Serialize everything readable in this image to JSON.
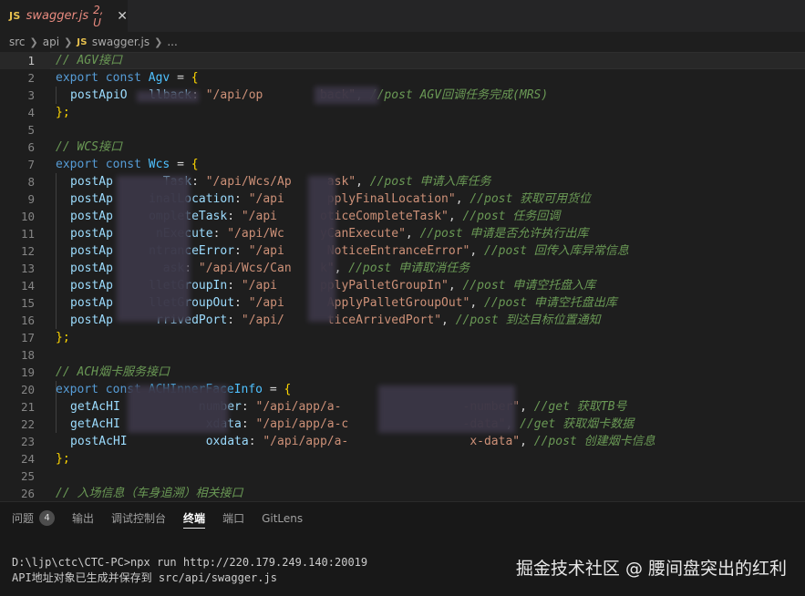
{
  "tab": {
    "badge": "JS",
    "name": "swagger.js",
    "status": "2, U",
    "close": "✕"
  },
  "breadcrumb": {
    "items": [
      "src",
      "api",
      "swagger.js",
      "..."
    ],
    "js_badge": "JS"
  },
  "editor": {
    "lines": [
      {
        "n": "1",
        "parts": [
          [
            "cm",
            "// AGV接口"
          ]
        ]
      },
      {
        "n": "2",
        "parts": [
          [
            "kw",
            "export"
          ],
          [
            "op",
            " "
          ],
          [
            "kw",
            "const"
          ],
          [
            "op",
            " "
          ],
          [
            "cls",
            "Agv"
          ],
          [
            "op",
            " = "
          ],
          [
            "br",
            "{"
          ]
        ]
      },
      {
        "n": "3",
        "indent": true,
        "parts": [
          [
            "id",
            "postApiO"
          ],
          [
            "op",
            "   "
          ],
          [
            "id",
            "llback"
          ],
          [
            "op",
            ": "
          ],
          [
            "str",
            "\"/api/op"
          ],
          [
            "op",
            "        "
          ],
          [
            "str",
            "back\""
          ],
          [
            "op",
            ", "
          ],
          [
            "cm",
            "//post AGV回调任务完成(MRS)"
          ]
        ]
      },
      {
        "n": "4",
        "parts": [
          [
            "br",
            "};"
          ]
        ]
      },
      {
        "n": "5",
        "parts": []
      },
      {
        "n": "6",
        "parts": [
          [
            "cm",
            "// WCS接口"
          ]
        ]
      },
      {
        "n": "7",
        "parts": [
          [
            "kw",
            "export"
          ],
          [
            "op",
            " "
          ],
          [
            "kw",
            "const"
          ],
          [
            "op",
            " "
          ],
          [
            "cls",
            "Wcs"
          ],
          [
            "op",
            " = "
          ],
          [
            "br",
            "{"
          ]
        ]
      },
      {
        "n": "8",
        "indent": true,
        "parts": [
          [
            "id",
            "postAp"
          ],
          [
            "op",
            "       "
          ],
          [
            "id",
            "Task"
          ],
          [
            "op",
            ": "
          ],
          [
            "str",
            "\"/api/Wcs/Ap"
          ],
          [
            "op",
            "     "
          ],
          [
            "str",
            "ask\""
          ],
          [
            "op",
            ", "
          ],
          [
            "cm",
            "//post 申请入库任务"
          ]
        ]
      },
      {
        "n": "9",
        "indent": true,
        "parts": [
          [
            "id",
            "postAp"
          ],
          [
            "op",
            "     "
          ],
          [
            "id",
            "inalLocation"
          ],
          [
            "op",
            ": "
          ],
          [
            "str",
            "\"/api"
          ],
          [
            "op",
            "      "
          ],
          [
            "str",
            "pplyFinalLocation\""
          ],
          [
            "op",
            ", "
          ],
          [
            "cm",
            "//post 获取可用货位"
          ]
        ]
      },
      {
        "n": "10",
        "indent": true,
        "parts": [
          [
            "id",
            "postAp"
          ],
          [
            "op",
            "     "
          ],
          [
            "id",
            "ompleteTask"
          ],
          [
            "op",
            ": "
          ],
          [
            "str",
            "\"/api"
          ],
          [
            "op",
            "      "
          ],
          [
            "str",
            "oticeCompleteTask\""
          ],
          [
            "op",
            ", "
          ],
          [
            "cm",
            "//post 任务回调"
          ]
        ]
      },
      {
        "n": "11",
        "indent": true,
        "parts": [
          [
            "id",
            "postAp"
          ],
          [
            "op",
            "      "
          ],
          [
            "id",
            "nExecute"
          ],
          [
            "op",
            ": "
          ],
          [
            "str",
            "\"/api/Wc"
          ],
          [
            "op",
            "     "
          ],
          [
            "str",
            "yCanExecute\""
          ],
          [
            "op",
            ", "
          ],
          [
            "cm",
            "//post 申请是否允许执行出库"
          ]
        ]
      },
      {
        "n": "12",
        "indent": true,
        "parts": [
          [
            "id",
            "postAp"
          ],
          [
            "op",
            "     "
          ],
          [
            "id",
            "ntranceError"
          ],
          [
            "op",
            ": "
          ],
          [
            "str",
            "\"/api"
          ],
          [
            "op",
            "      "
          ],
          [
            "str",
            "NoticeEntranceError\""
          ],
          [
            "op",
            ", "
          ],
          [
            "cm",
            "//post 回传入库异常信息"
          ]
        ]
      },
      {
        "n": "13",
        "indent": true,
        "parts": [
          [
            "id",
            "postAp"
          ],
          [
            "op",
            "       "
          ],
          [
            "id",
            "ask"
          ],
          [
            "op",
            ": "
          ],
          [
            "str",
            "\"/api/Wcs/Can"
          ],
          [
            "op",
            "    "
          ],
          [
            "str",
            "k\""
          ],
          [
            "op",
            ", "
          ],
          [
            "cm",
            "//post 申请取消任务"
          ]
        ]
      },
      {
        "n": "14",
        "indent": true,
        "parts": [
          [
            "id",
            "postAp"
          ],
          [
            "op",
            "     "
          ],
          [
            "id",
            "lletGroupIn"
          ],
          [
            "op",
            ": "
          ],
          [
            "str",
            "\"/api"
          ],
          [
            "op",
            "      "
          ],
          [
            "str",
            "pplyPalletGroupIn\""
          ],
          [
            "op",
            ", "
          ],
          [
            "cm",
            "//post 申请空托盘入库"
          ]
        ]
      },
      {
        "n": "15",
        "indent": true,
        "parts": [
          [
            "id",
            "postAp"
          ],
          [
            "op",
            "     "
          ],
          [
            "id",
            "lletGroupOut"
          ],
          [
            "op",
            ": "
          ],
          [
            "str",
            "\"/api"
          ],
          [
            "op",
            "      "
          ],
          [
            "str",
            "ApplyPalletGroupOut\""
          ],
          [
            "op",
            ", "
          ],
          [
            "cm",
            "//post 申请空托盘出库"
          ]
        ]
      },
      {
        "n": "16",
        "indent": true,
        "parts": [
          [
            "id",
            "postAp"
          ],
          [
            "op",
            "      "
          ],
          [
            "id",
            "rrivedPort"
          ],
          [
            "op",
            ": "
          ],
          [
            "str",
            "\"/api/"
          ],
          [
            "op",
            "      "
          ],
          [
            "str",
            "ticeArrivedPort\""
          ],
          [
            "op",
            ", "
          ],
          [
            "cm",
            "//post 到达目标位置通知"
          ]
        ]
      },
      {
        "n": "17",
        "parts": [
          [
            "br",
            "};"
          ]
        ]
      },
      {
        "n": "18",
        "parts": []
      },
      {
        "n": "19",
        "parts": [
          [
            "cm",
            "// ACH烟卡服务接口"
          ]
        ]
      },
      {
        "n": "20",
        "parts": [
          [
            "kw",
            "export"
          ],
          [
            "op",
            " "
          ],
          [
            "kw",
            "const"
          ],
          [
            "op",
            " "
          ],
          [
            "cls",
            "ACHInnerFaceInfo"
          ],
          [
            "op",
            " = "
          ],
          [
            "br",
            "{"
          ]
        ]
      },
      {
        "n": "21",
        "indent": true,
        "parts": [
          [
            "id",
            "getAcHI"
          ],
          [
            "op",
            "           "
          ],
          [
            "id",
            "number"
          ],
          [
            "op",
            ": "
          ],
          [
            "str",
            "\"/api/app/a-"
          ],
          [
            "op",
            "                 "
          ],
          [
            "str",
            "-number\""
          ],
          [
            "op",
            ", "
          ],
          [
            "cm",
            "//get 获取TB号"
          ]
        ]
      },
      {
        "n": "22",
        "indent": true,
        "parts": [
          [
            "id",
            "getAcHI"
          ],
          [
            "op",
            "            "
          ],
          [
            "id",
            "xdata"
          ],
          [
            "op",
            ": "
          ],
          [
            "str",
            "\"/api/app/a-c"
          ],
          [
            "op",
            "                "
          ],
          [
            "str",
            "-data\""
          ],
          [
            "op",
            ", "
          ],
          [
            "cm",
            "//get 获取烟卡数据"
          ]
        ]
      },
      {
        "n": "23",
        "indent": true,
        "parts": [
          [
            "id",
            "postAcHI"
          ],
          [
            "op",
            "           "
          ],
          [
            "id",
            "oxdata"
          ],
          [
            "op",
            ": "
          ],
          [
            "str",
            "\"/api/app/a-"
          ],
          [
            "op",
            "                 "
          ],
          [
            "str",
            "x-data\""
          ],
          [
            "op",
            ", "
          ],
          [
            "cm",
            "//post 创建烟卡信息"
          ]
        ]
      },
      {
        "n": "24",
        "parts": [
          [
            "br",
            "};"
          ]
        ]
      },
      {
        "n": "25",
        "parts": []
      },
      {
        "n": "26",
        "parts": [
          [
            "cm",
            "// 入场信息（车身追溯）相关接口"
          ]
        ]
      }
    ]
  },
  "panel": {
    "tabs": [
      {
        "label": "问题",
        "badge": "4"
      },
      {
        "label": "输出"
      },
      {
        "label": "调试控制台"
      },
      {
        "label": "终端",
        "active": true
      },
      {
        "label": "端口"
      },
      {
        "label": "GitLens"
      }
    ],
    "terminal": [
      "D:\\ljp\\ctc\\CTC-PC>npx run http://220.179.249.140:20019",
      "API地址对象已生成并保存到 src/api/swagger.js"
    ]
  },
  "watermark": "掘金技术社区 @ 腰间盘突出的红利"
}
